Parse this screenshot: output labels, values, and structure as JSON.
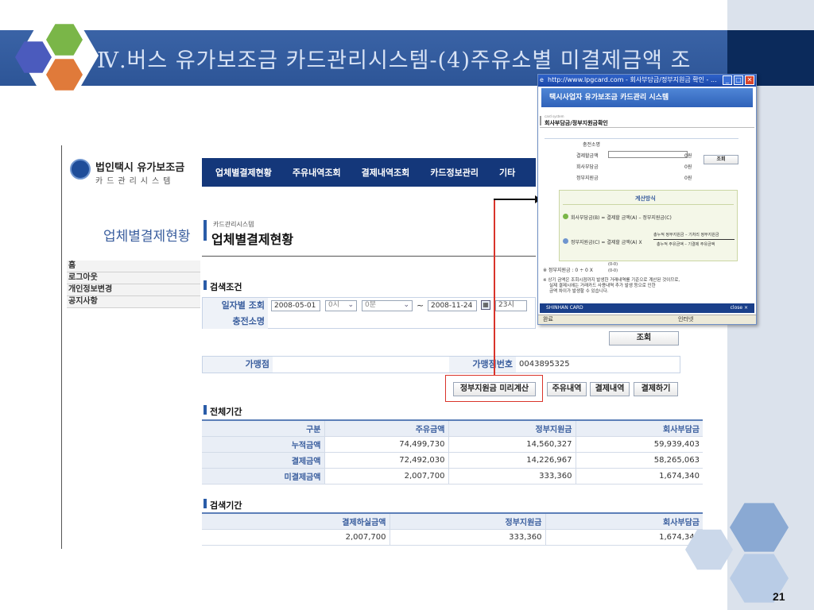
{
  "slide": {
    "title": "Ⅳ.버스 유가보조금 카드관리시스템-(4)주유소별 미결제금액 조",
    "number": "21"
  },
  "app": {
    "logo_title": "법인택시 유가보조금",
    "logo_sub": "카드관리시스템",
    "nav": [
      "업체별결제현황",
      "주유내역조회",
      "결제내역조회",
      "카드정보관리",
      "기타"
    ],
    "page_heading_left": "업체별결제현황",
    "breadcrumb": "카드관리시스템",
    "page_heading": "업체별결제현황",
    "side_menu": [
      "홈",
      "로그아웃",
      "개인정보변경",
      "공지사항"
    ]
  },
  "search": {
    "section_title": "검색조건",
    "date_label": "일자별 조회",
    "date_from": "2008-05-01",
    "hour_from": "0시",
    "minute_from": "0분",
    "tilde": "~",
    "date_to": "2008-11-24",
    "hour_to": "23시",
    "station_label": "충전소명",
    "search_button": "조회"
  },
  "merchant": {
    "name_label": "가맹점",
    "number_label": "가맹점번호",
    "number_value": "0043895325"
  },
  "actions": {
    "preview_button": "정부지원금 미리계산",
    "fuel_button": "주유내역",
    "payment_button": "결제내역",
    "pay_button": "결제하기"
  },
  "total_period": {
    "section_title": "전체기간",
    "headers": [
      "구분",
      "주유금액",
      "정부지원금",
      "회사부담금"
    ],
    "rows": [
      {
        "label": "누적금액",
        "fuel": "74,499,730",
        "gov": "14,560,327",
        "company": "59,939,403"
      },
      {
        "label": "결제금액",
        "fuel": "72,492,030",
        "gov": "14,226,967",
        "company": "58,265,063"
      },
      {
        "label": "미결제금액",
        "fuel": "2,007,700",
        "gov": "333,360",
        "company": "1,674,340"
      }
    ]
  },
  "search_period": {
    "section_title": "검색기간",
    "headers": [
      "결제하실금액",
      "정부지원금",
      "회사부담금"
    ],
    "row": {
      "amount": "2,007,700",
      "gov": "333,360",
      "company": "1,674,340"
    }
  },
  "popup": {
    "window_title": "http://www.lpgcard.com - 회사부담금/정부지원금 확인 - ...",
    "header": "택시사업자 유가보조금 카드관리 시스템",
    "card_system": "card system",
    "subtitle": "회사부담금/정부지원금확인",
    "fields": [
      {
        "label": "충전소명",
        "value": ""
      },
      {
        "label": "결제할금액",
        "value": "0원"
      },
      {
        "label": "회사부담금",
        "value": "0원"
      },
      {
        "label": "정부지원금",
        "value": "0원"
      }
    ],
    "search_button": "조회",
    "calc_title": "계산방식",
    "formula1": "회사부담금(B) = 결제할 금액(A) – 정부지원금(C)",
    "formula2_left": "정부지원금(C) = 결제할 금액(A)  X",
    "formula2_num": "총누적 정부지원금 – 기처리 정부지원금",
    "formula2_den": "총누적 주유금액 – 기결제 주유금액",
    "note1": "※ 정부지원금 : 0 ÷ 0 X",
    "note1_frac": "(0-0)",
    "note1_frac2": "(0-0)",
    "note2": "※ 상기 금액은 조회시점까지 발생한 거래내역를 기준으로 계산된 것이므로,",
    "note3": "실제 결제시에는 거래카드 사용내역 추가 발생 등으로 인한",
    "note4": "금액 차이가 발생할 수 있습니다.",
    "footer_brand": "SHINHAN CARD",
    "footer_close": "close ×",
    "status_left": "완료",
    "status_right": "인터넷"
  },
  "colors": {
    "title_bar": "#2d5597",
    "nav_bar": "#14377a",
    "highlight_red": "#d9342b",
    "label_blue": "#3a5e9e"
  }
}
